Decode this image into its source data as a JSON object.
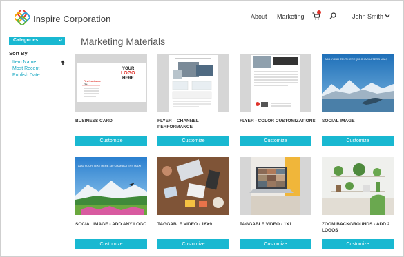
{
  "header": {
    "brand": "Inspire Corporation",
    "nav": {
      "about": "About",
      "marketing": "Marketing"
    },
    "user": "John Smith"
  },
  "sidebar": {
    "categories_label": "Categories",
    "sort_by": "Sort By",
    "sort_options": [
      "Item Name",
      "Most Recent",
      "Publish Date"
    ]
  },
  "main": {
    "title": "Marketing Materials",
    "cards": [
      {
        "title": "BUSINESS CARD",
        "button": "Customize",
        "thumb_text": [
          "YOUR",
          "LOGO",
          "HERE",
          "First Lastname",
          "Title"
        ]
      },
      {
        "title": "FLYER – CHANNEL PERFORMANCE",
        "button": "Customize"
      },
      {
        "title": "FLYER - COLOR CUSTOMIZATIONS",
        "button": "Customize"
      },
      {
        "title": "SOCIAL IMAGE",
        "button": "Customize",
        "thumb_text": [
          "ADD YOUR TEXT HERE (30 CHARACTERS MAX)"
        ]
      },
      {
        "title": "SOCIAL IMAGE - ADD ANY LOGO",
        "button": "Customize",
        "thumb_text": [
          "ADD YOUR TEXT HERE (30 CHARACTERS MAX)"
        ]
      },
      {
        "title": "TAGGABLE VIDEO - 16X9",
        "button": "Customize"
      },
      {
        "title": "TAGGABLE VIDEO - 1X1",
        "button": "Customize"
      },
      {
        "title": "ZOOM BACKGROUNDS - ADD 2 LOGOS",
        "button": "Customize"
      }
    ]
  },
  "colors": {
    "accent": "#19b8d1",
    "link": "#1aa8c2",
    "badge": "#e0332b"
  },
  "icons": [
    "logo-icon",
    "cart-icon",
    "search-icon",
    "chevron-down-icon",
    "sort-arrow-icon"
  ]
}
